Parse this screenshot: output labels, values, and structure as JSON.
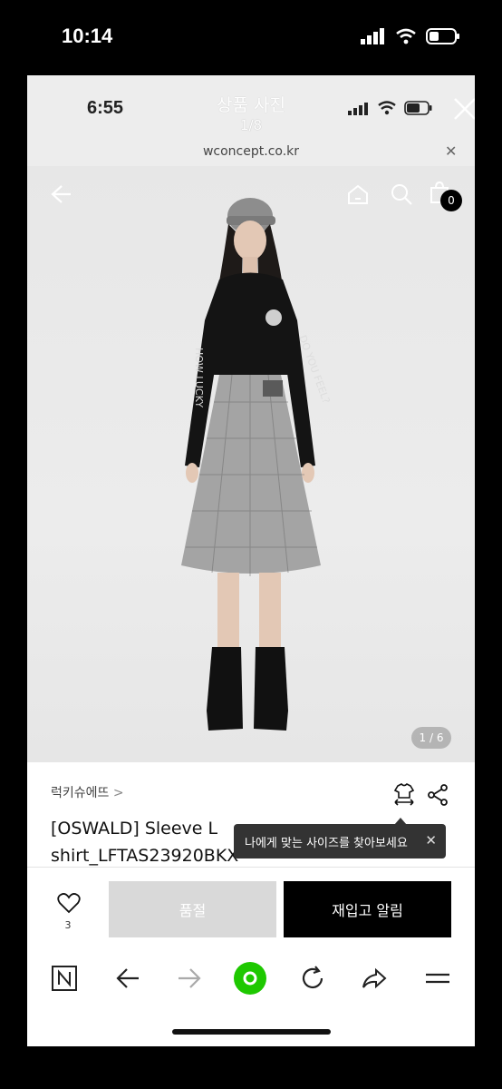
{
  "phone_status": {
    "time": "10:14"
  },
  "viewer": {
    "inner_time": "6:55",
    "title": "상품 사진",
    "counter": "1/8",
    "url": "wconcept.co.kr"
  },
  "product_page": {
    "cart_count": "0",
    "image_counter": "1 / 6",
    "brand": "럭키슈에뜨",
    "title_line1": "[OSWALD] Sleeve L",
    "title_line2": "shirt_LFTAS23920BKX",
    "tooltip": "나에게 맞는 사이즈를 찾아보세요",
    "like_count": "3",
    "soldout_label": "품절",
    "restock_label": "재입고 알림"
  },
  "colors": {
    "sold_out_bg": "#d9d9d9",
    "primary_button": "#000000",
    "naver_green": "#1ec800"
  },
  "icons": [
    "back-arrow-icon",
    "home-icon",
    "search-icon",
    "shopping-bag-icon",
    "size-guide-icon",
    "share-icon",
    "heart-icon",
    "naver-n-icon",
    "nav-back-icon",
    "nav-forward-icon",
    "naver-green-dot-icon",
    "refresh-icon",
    "share-arrow-icon",
    "menu-icon"
  ]
}
